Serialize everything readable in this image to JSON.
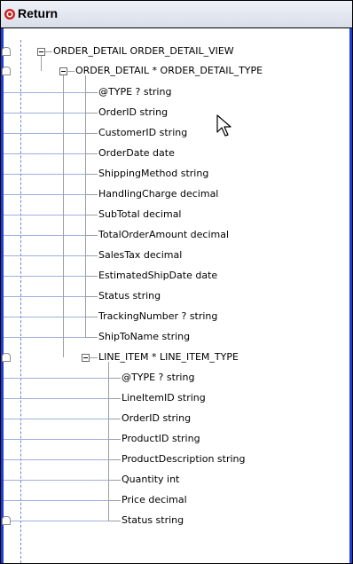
{
  "window": {
    "title": "Return",
    "title_icon": "target-icon",
    "accent_color": "#1f3fd4",
    "icon_color": "#cc1f1f"
  },
  "tree": {
    "root": {
      "label": "ORDER_DETAIL ORDER_DETAIL_VIEW",
      "expanded": true
    },
    "order_detail": {
      "label": "ORDER_DETAIL * ORDER_DETAIL_TYPE",
      "expanded": true,
      "fields": [
        "@TYPE ? string",
        "OrderID string",
        "CustomerID string",
        "OrderDate date",
        "ShippingMethod string",
        "HandlingCharge decimal",
        "SubTotal decimal",
        "TotalOrderAmount decimal",
        "SalesTax decimal",
        "EstimatedShipDate date",
        "Status string",
        "TrackingNumber ? string",
        "ShipToName string"
      ]
    },
    "line_item": {
      "label": "LINE_ITEM * LINE_ITEM_TYPE",
      "expanded": true,
      "fields": [
        "@TYPE ? string",
        "LineItemID string",
        "OrderID string",
        "ProductID string",
        "ProductDescription string",
        "Quantity int",
        "Price decimal",
        "Status string"
      ]
    }
  }
}
